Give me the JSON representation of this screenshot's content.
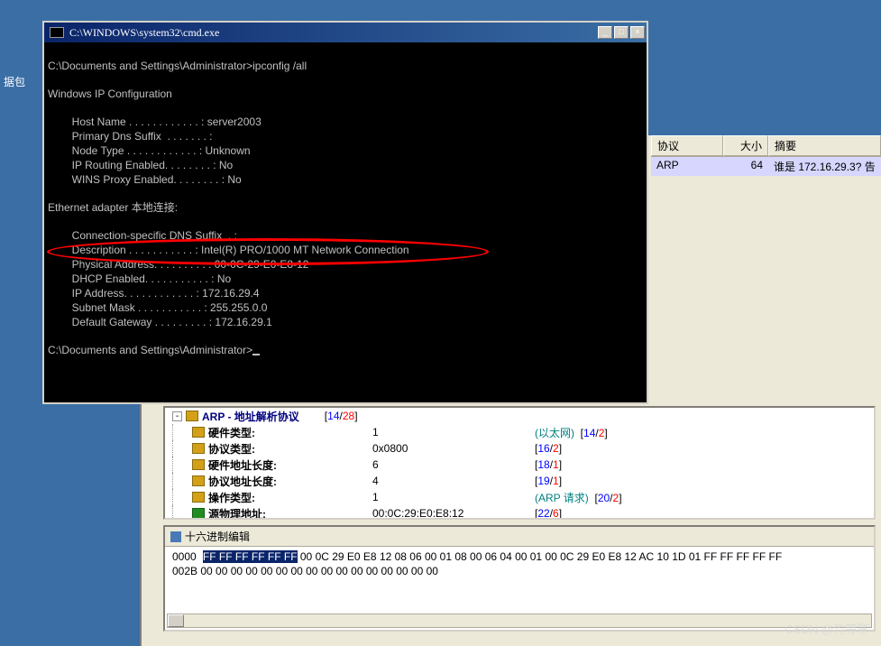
{
  "desktop": {
    "icon_label": "据包"
  },
  "cmd": {
    "title": "C:\\WINDOWS\\system32\\cmd.exe",
    "controls": {
      "min": "_",
      "max": "□",
      "close": "×"
    },
    "lines": {
      "l1": "C:\\Documents and Settings\\Administrator>ipconfig /all",
      "l2": "Windows IP Configuration",
      "l3": "        Host Name . . . . . . . . . . . . : server2003",
      "l4": "        Primary Dns Suffix  . . . . . . . :",
      "l5": "        Node Type . . . . . . . . . . . . : Unknown",
      "l6": "        IP Routing Enabled. . . . . . . . : No",
      "l7": "        WINS Proxy Enabled. . . . . . . . : No",
      "l8": "Ethernet adapter 本地连接:",
      "l9": "        Connection-specific DNS Suffix  . :",
      "l10": "        Description . . . . . . . . . . . : Intel(R) PRO/1000 MT Network Connection",
      "l11": "        Physical Address. . . . . . . . . : 00-0C-29-E0-E8-12",
      "l12": "        DHCP Enabled. . . . . . . . . . . : No",
      "l13": "        IP Address. . . . . . . . . . . . : 172.16.29.4",
      "l14": "        Subnet Mask . . . . . . . . . . . : 255.255.0.0",
      "l15": "        Default Gateway . . . . . . . . . : 172.16.29.1",
      "l16": "C:\\Documents and Settings\\Administrator>"
    }
  },
  "packet_table": {
    "headers": {
      "proto": "协议",
      "len": "大小",
      "info": "摘要"
    },
    "row": {
      "proto": "ARP",
      "len": "64",
      "info": "谁是 172.16.29.3? 告"
    }
  },
  "tree": {
    "arp_header": {
      "label": "ARP - 地址解析协议",
      "count_a": "14",
      "count_b": "28"
    },
    "hw_type": {
      "label": "硬件类型:",
      "value": "1",
      "note": "(以太网)",
      "b1": "14",
      "b2": "2"
    },
    "proto_type": {
      "label": "协议类型:",
      "value": "0x0800",
      "b1": "16",
      "b2": "2"
    },
    "hw_len": {
      "label": "硬件地址长度:",
      "value": "6",
      "b1": "18",
      "b2": "1"
    },
    "proto_len": {
      "label": "协议地址长度:",
      "value": "4",
      "b1": "19",
      "b2": "1"
    },
    "op": {
      "label": "操作类型:",
      "value": "1",
      "note": "(ARP 请求)",
      "b1": "20",
      "b2": "2"
    },
    "src_hw": {
      "label": "源物理地址:",
      "value": "00:0C:29:E0:E8:12",
      "b1": "22",
      "b2": "6"
    }
  },
  "hex": {
    "title": "十六进制编辑",
    "r1_off": "0000",
    "r1_sel": "FF FF FF FF FF FF",
    "r1_rest": " 00 0C 29 E0 E8 12 08 06 00 01 08 00 06 04 00 01 00 0C 29 E0 E8 12 AC 10 1D 01 FF FF FF FF FF",
    "r2_off": "002B",
    "r2_rest": " 00 00 00 00 00 00 00 00 00 00 00 00 00 00 00 00"
  },
  "watermark": "CSDN @竹等寒"
}
